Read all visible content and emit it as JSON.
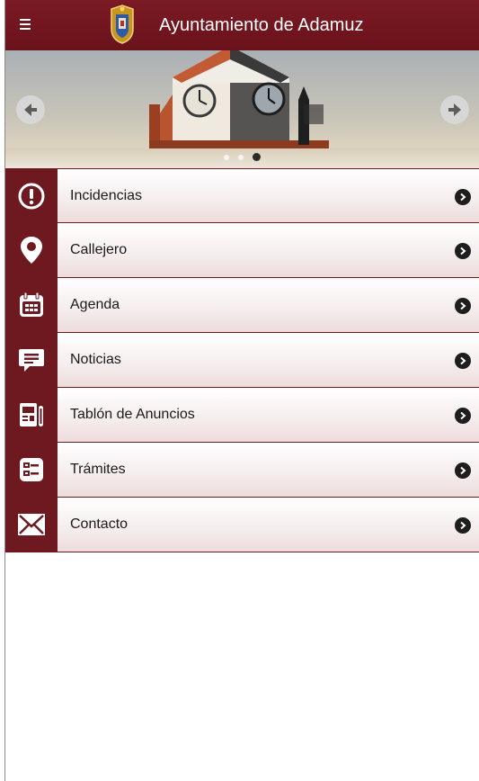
{
  "header": {
    "title": "Ayuntamiento de Adamuz",
    "menu_icon": "hamburger-icon",
    "crest_icon": "coat-of-arms-icon"
  },
  "carousel": {
    "prev_icon": "arrow-left-icon",
    "next_icon": "arrow-right-icon",
    "slide_count": 3,
    "active_slide": 3
  },
  "menu": {
    "items": [
      {
        "label": "Incidencias",
        "icon": "alert-circle-icon"
      },
      {
        "label": "Callejero",
        "icon": "map-pin-icon"
      },
      {
        "label": "Agenda",
        "icon": "calendar-icon"
      },
      {
        "label": "Noticias",
        "icon": "chat-bubble-icon"
      },
      {
        "label": "Tablón de Anuncios",
        "icon": "bulletin-board-icon"
      },
      {
        "label": "Trámites",
        "icon": "form-icon"
      },
      {
        "label": "Contacto",
        "icon": "envelope-icon"
      }
    ]
  },
  "colors": {
    "brand": "#6e1820",
    "header": "#7a1a24"
  }
}
